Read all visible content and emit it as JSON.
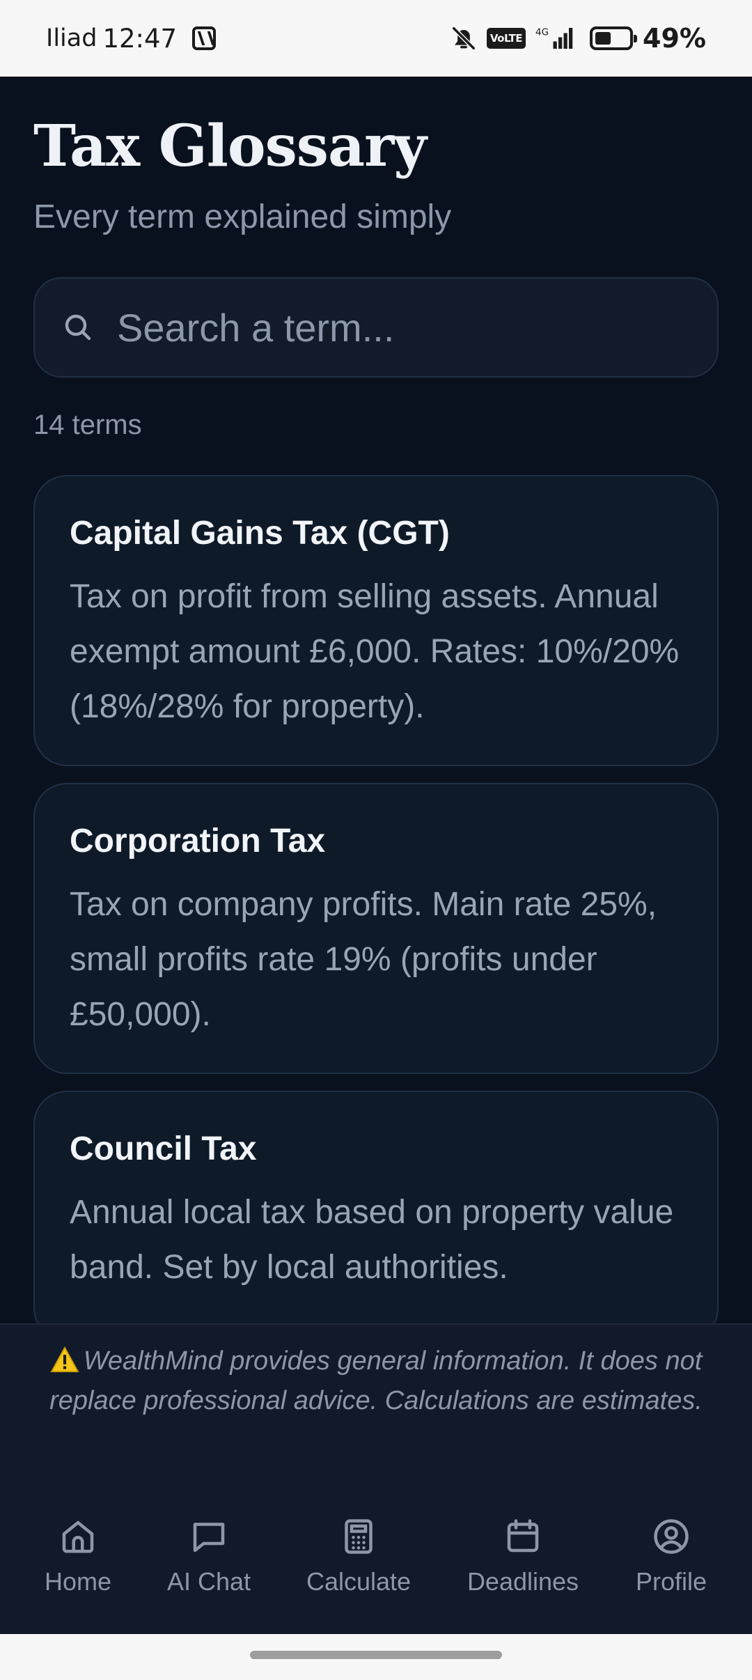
{
  "status_bar": {
    "carrier": "Iliad",
    "time": "12:47",
    "volte": "VoLTE",
    "battery": "49%"
  },
  "header": {
    "title": "Tax Glossary",
    "subtitle": "Every term explained simply"
  },
  "search": {
    "placeholder": "Search a term..."
  },
  "term_count": "14 terms",
  "terms": [
    {
      "title": "Capital Gains Tax (CGT)",
      "description": "Tax on profit from selling assets. Annual exempt amount £6,000. Rates: 10%/20% (18%/28% for property)."
    },
    {
      "title": "Corporation Tax",
      "description": "Tax on company profits. Main rate 25%, small profits rate 19% (profits under £50,000)."
    },
    {
      "title": "Council Tax",
      "description": "Annual local tax based on property value band. Set by local authorities."
    }
  ],
  "disclaimer": "WealthMind provides general information. It does not replace professional advice. Calculations are estimates.",
  "nav": [
    {
      "label": "Home",
      "icon": "home-icon"
    },
    {
      "label": "AI Chat",
      "icon": "chat-icon"
    },
    {
      "label": "Calculate",
      "icon": "calculator-icon"
    },
    {
      "label": "Deadlines",
      "icon": "calendar-icon"
    },
    {
      "label": "Profile",
      "icon": "profile-icon"
    }
  ],
  "colors": {
    "background": "#0a111e",
    "card": "#0f1a29",
    "muted_text": "#8c98a9",
    "warning": "#f5c518"
  }
}
